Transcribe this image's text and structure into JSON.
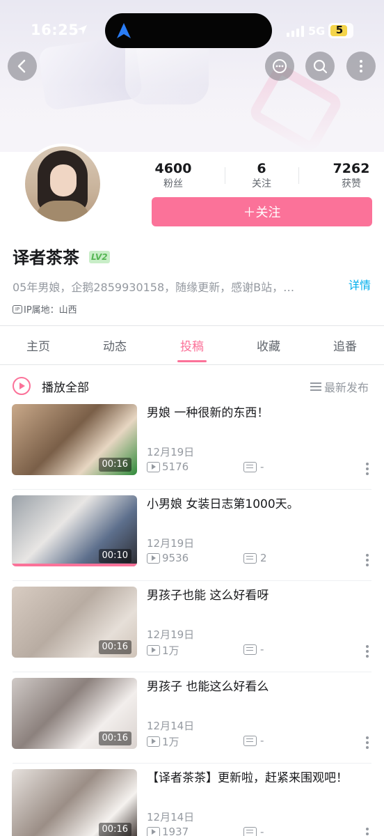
{
  "status_bar": {
    "time": "16:25",
    "network": "5G",
    "battery": "5"
  },
  "profile": {
    "name": "译者茶茶",
    "level": "LV2",
    "stats": [
      {
        "value": "4600",
        "label": "粉丝"
      },
      {
        "value": "6",
        "label": "关注"
      },
      {
        "value": "7262",
        "label": "获赞"
      }
    ],
    "follow_label": "＋关注",
    "signature": "05年男娘，企鹅2859930158，随缘更新，感谢B站，…",
    "detail_label": "详情",
    "ip_icon": "IP",
    "ip_location": "IP属地：山西"
  },
  "tabs": [
    "主页",
    "动态",
    "投稿",
    "收藏",
    "追番"
  ],
  "active_tab": "投稿",
  "list_header": {
    "play_all": "播放全部",
    "sort": "最新发布"
  },
  "videos": [
    {
      "title": "男娘 一种很新的东西！",
      "date": "12月19日",
      "plays": "5176",
      "danmaku": "-",
      "duration": "00:16",
      "progress": 0
    },
    {
      "title": "小男娘 女装日志第1000天。",
      "date": "12月19日",
      "plays": "9536",
      "danmaku": "2",
      "duration": "00:10",
      "progress": 1.0
    },
    {
      "title": "男孩子也能 这么好看呀",
      "date": "12月19日",
      "plays": "1万",
      "danmaku": "-",
      "duration": "00:16",
      "progress": 0
    },
    {
      "title": "男孩子 也能这么好看么",
      "date": "12月14日",
      "plays": "1万",
      "danmaku": "-",
      "duration": "00:16",
      "progress": 0
    },
    {
      "title": "【译者茶茶】更新啦，赶紧来围观吧！",
      "date": "12月14日",
      "plays": "1937",
      "danmaku": "-",
      "duration": "00:16",
      "progress": 0
    }
  ],
  "colors": {
    "accent": "#fb7299",
    "link": "#00aeec",
    "muted": "#9499a0"
  }
}
